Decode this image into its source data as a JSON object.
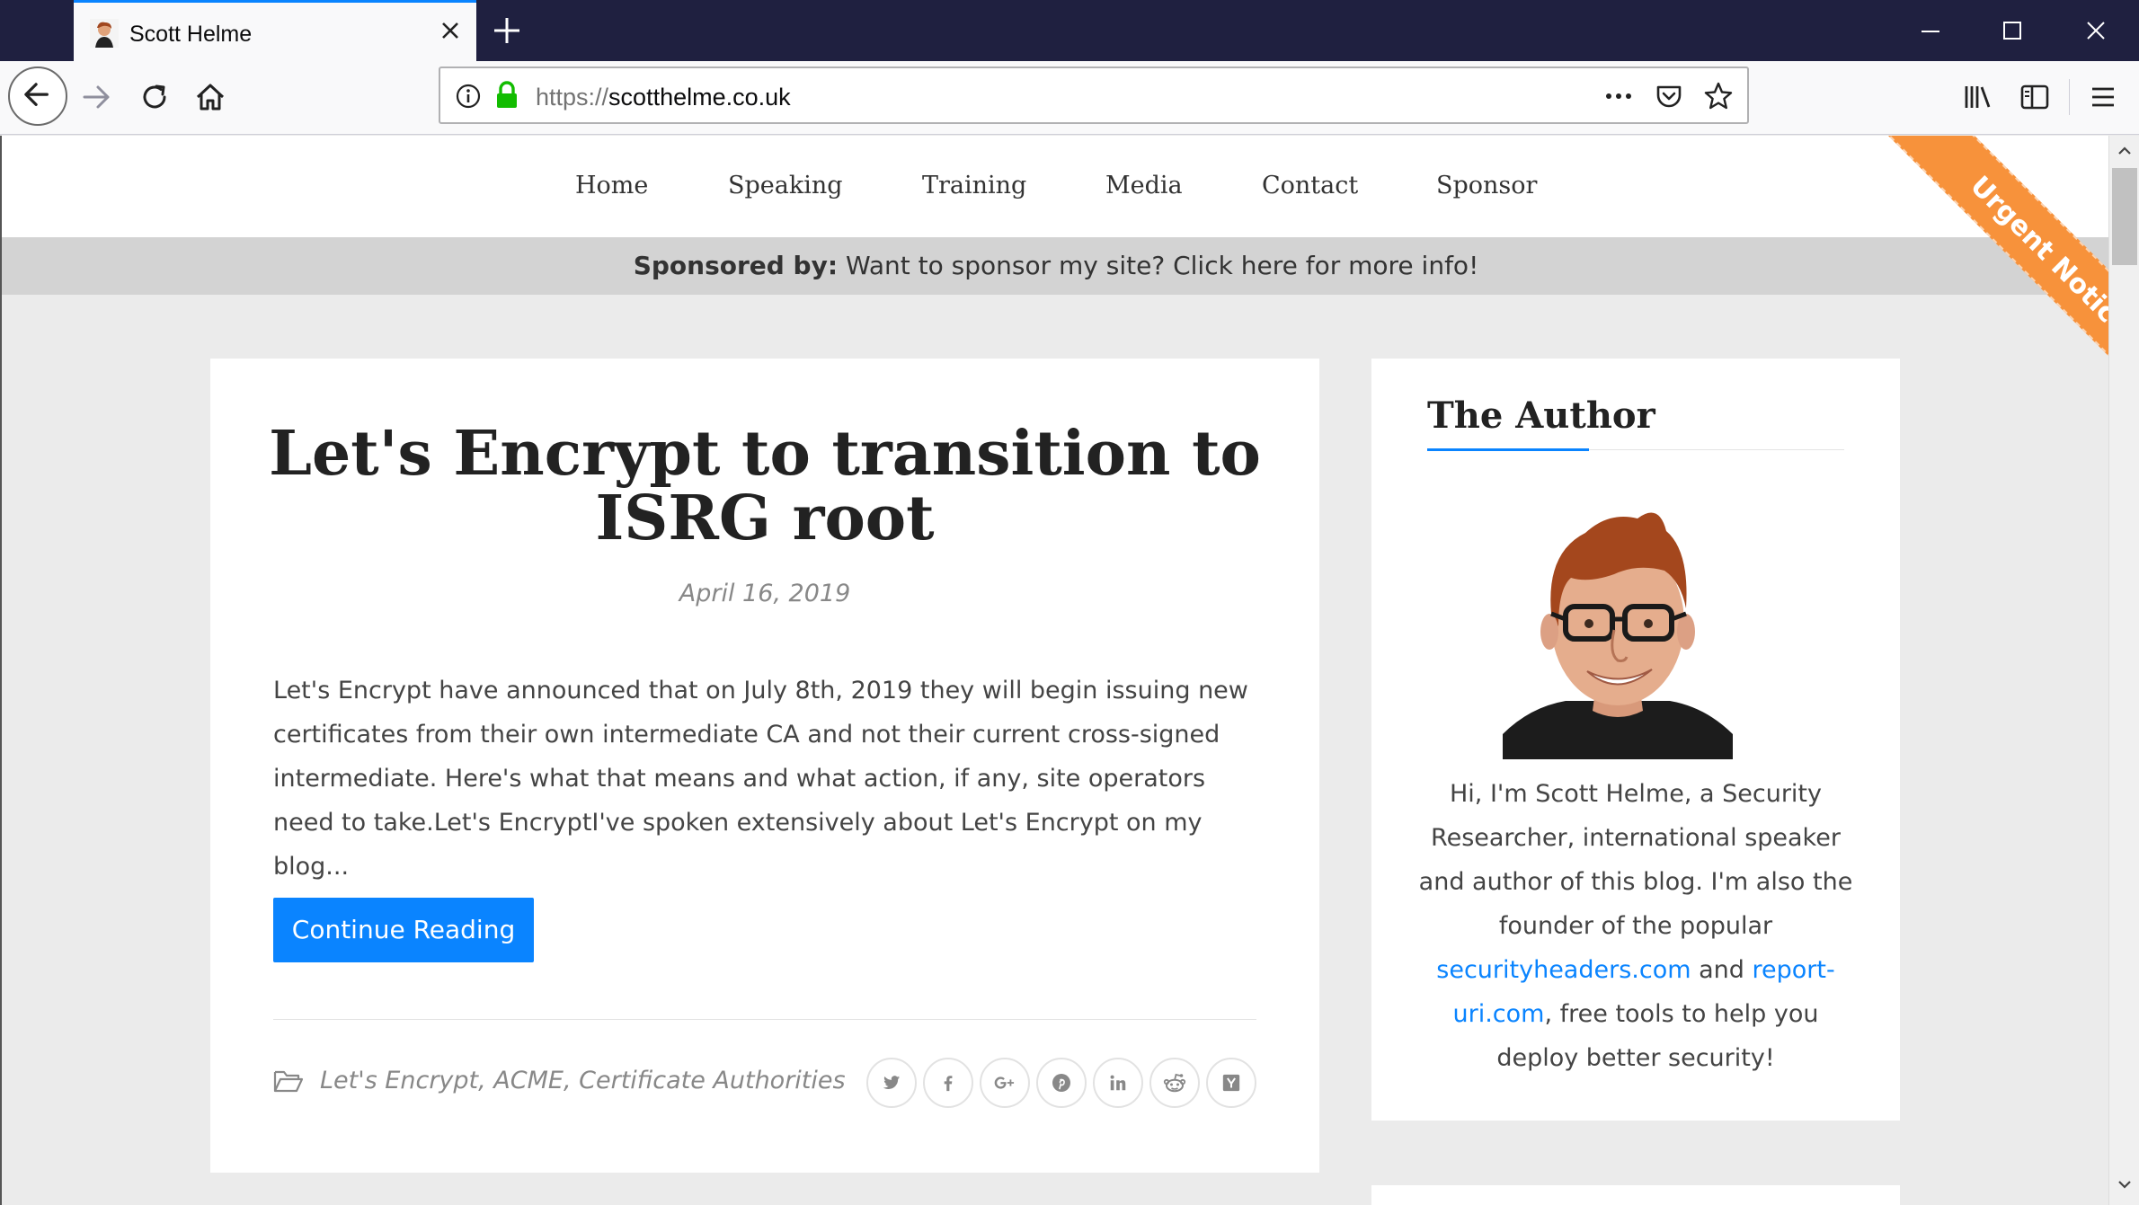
{
  "browser": {
    "tab_title": "Scott Helme",
    "url_protocol": "https://",
    "url_host": "scotthelme.co.uk"
  },
  "site_nav": {
    "items": [
      "Home",
      "Speaking",
      "Training",
      "Media",
      "Contact",
      "Sponsor"
    ]
  },
  "sponsor_bar": {
    "label": "Sponsored by:",
    "text": "Want to sponsor my site? Click here for more info!"
  },
  "ribbon": {
    "text": "Urgent Notice",
    "color": "#f7923b"
  },
  "post": {
    "title": "Let's Encrypt to transition to ISRG root",
    "date": "April 16, 2019",
    "excerpt": "Let's Encrypt have announced that on July 8th, 2019 they will begin issuing new certificates from their own intermediate CA and not their current cross-signed intermediate. Here's what that means and what action, if any, site operators need to take.Let's EncryptI've spoken extensively about Let's Encrypt on my blog...",
    "continue_label": "Continue Reading",
    "categories": "Let's Encrypt,  ACME,  Certificate Authorities",
    "share_icons": [
      "twitter-icon",
      "facebook-icon",
      "google-plus-icon",
      "pinterest-icon",
      "linkedin-icon",
      "reddit-icon",
      "hacker-news-icon"
    ]
  },
  "author": {
    "heading": "The Author",
    "bio_1": "Hi, I'm Scott Helme, a Security Researcher, international speaker and author of this blog. I'm also the founder of the popular ",
    "link_1": "securityheaders.com",
    "bio_2": " and ",
    "link_2": "report-uri.com",
    "bio_3": ", free tools to help you deploy better security!"
  },
  "colors": {
    "accent": "#0a84ff",
    "titlebar": "#1f2040",
    "sponsor_bar": "#d3d3d3"
  }
}
